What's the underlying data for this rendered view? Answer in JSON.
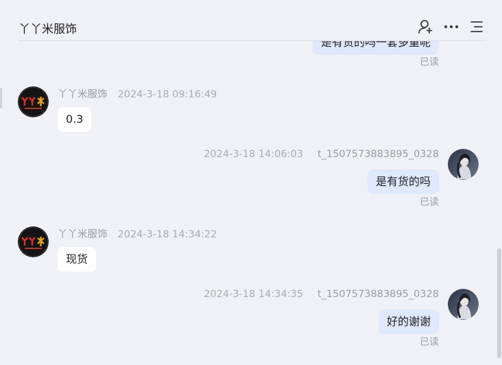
{
  "header": {
    "title": "丫丫米服饰",
    "icons": [
      "add-user-icon",
      "more-icon",
      "menu-icon"
    ]
  },
  "messages": [
    {
      "side": "right",
      "text": "是有货的吗一套多重呢",
      "read": "已读"
    },
    {
      "side": "left",
      "name": "丫丫米服饰",
      "time": "2024-3-18 09:16:49",
      "text": "0.3"
    },
    {
      "side": "right",
      "name": "t_1507573883895_0328",
      "time": "2024-3-18 14:06:03",
      "text": "是有货的吗",
      "read": "已读"
    },
    {
      "side": "left",
      "name": "丫丫米服饰",
      "time": "2024-3-18 14:34:22",
      "text": "现货"
    },
    {
      "side": "right",
      "name": "t_1507573883895_0328",
      "time": "2024-3-18 14:34:35",
      "text": "好的谢谢",
      "read": "已读"
    }
  ],
  "colors": {
    "background": "#f0f1f6",
    "bubble_left": "#ffffff",
    "bubble_right": "#dfe8fd",
    "meta_text": "#a9abb1"
  }
}
